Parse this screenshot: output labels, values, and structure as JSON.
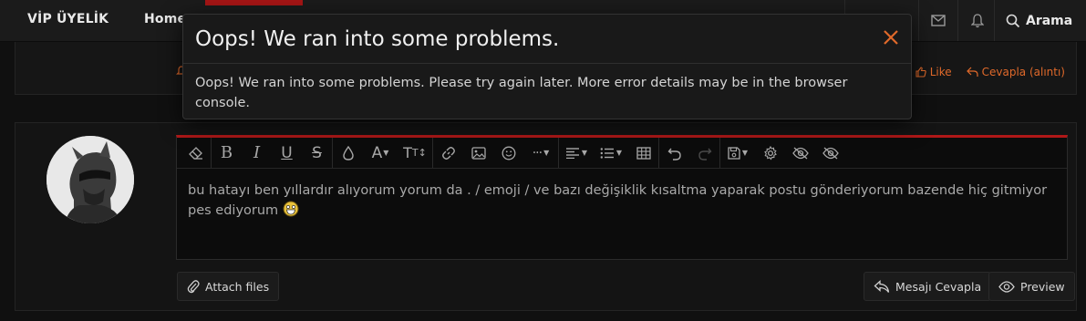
{
  "nav": {
    "brand": "VİP ÜYELİK",
    "home": "Home",
    "search_label": "Arama"
  },
  "previous_post": {
    "like_label": "Like",
    "reply_quote_label": "Cevapla (alıntı)"
  },
  "editor": {
    "content": "bu hatayı ben yıllardır alıyorum yorum da . / emoji / ve bazı değişiklik kısaltma yaparak postu gönderiyorum bazende hiç gitmiyor pes ediyorum",
    "toolbar_icons": [
      "eraser-icon",
      "bold-icon",
      "italic-icon",
      "underline-icon",
      "strikethrough-icon",
      "text-color-icon",
      "font-family-icon",
      "font-size-icon",
      "link-icon",
      "image-icon",
      "smilie-icon",
      "more-icon",
      "align-icon",
      "list-icon",
      "table-icon",
      "undo-icon",
      "redo-icon",
      "drafts-icon",
      "settings-icon",
      "toggle-bbcode-icon",
      "preview-eye-icon"
    ]
  },
  "actions": {
    "attach_files": "Attach files",
    "reply_button": "Mesajı Cevapla",
    "preview_button": "Preview"
  },
  "modal": {
    "title": "Oops! We ran into some problems.",
    "message": "Oops! We ran into some problems. Please try again later. More error details may be in the browser console."
  },
  "colors": {
    "accent_red": "#b01818",
    "link_orange": "#e0692a",
    "close_orange": "#e0692a"
  }
}
